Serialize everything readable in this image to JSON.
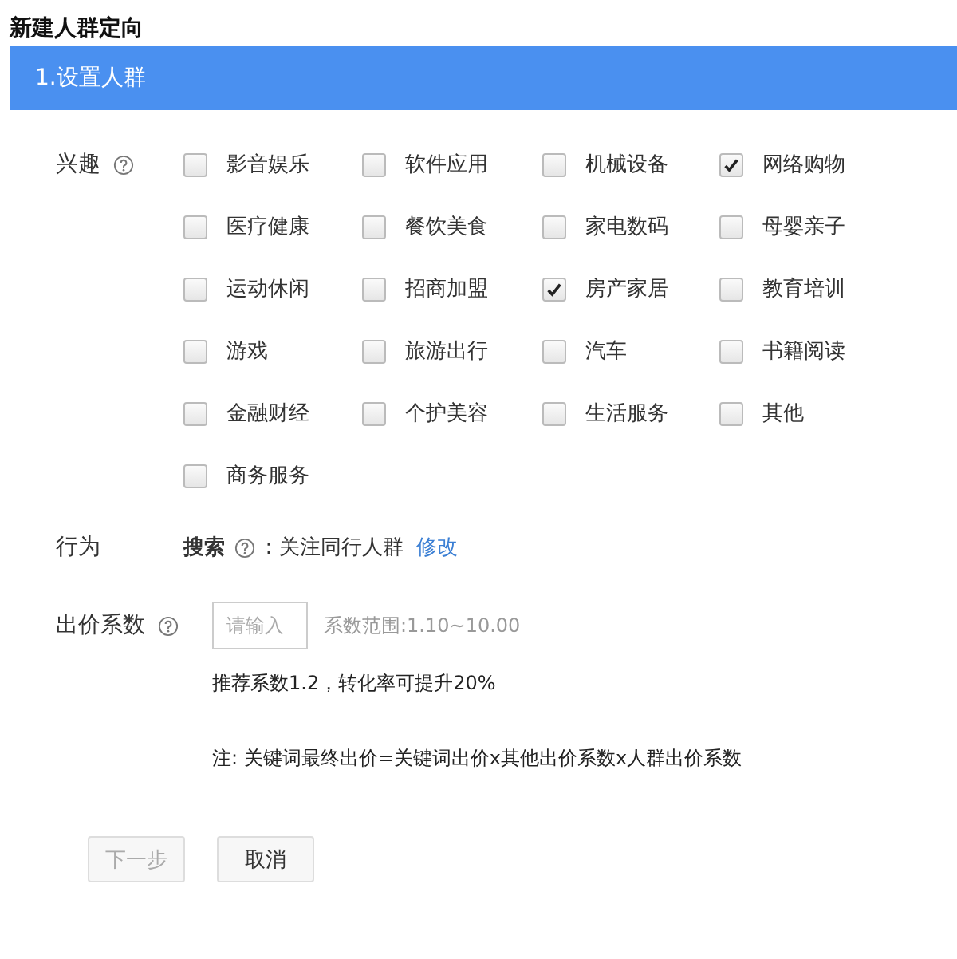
{
  "page_title": "新建人群定向",
  "step": {
    "label": "1.设置人群",
    "selected": true
  },
  "interests": {
    "label": "兴趣",
    "items": [
      {
        "label": "影音娱乐",
        "checked": false
      },
      {
        "label": "软件应用",
        "checked": false
      },
      {
        "label": "机械设备",
        "checked": false
      },
      {
        "label": "网络购物",
        "checked": true
      },
      {
        "label": "医疗健康",
        "checked": false
      },
      {
        "label": "餐饮美食",
        "checked": false
      },
      {
        "label": "家电数码",
        "checked": false
      },
      {
        "label": "母婴亲子",
        "checked": false
      },
      {
        "label": "运动休闲",
        "checked": false
      },
      {
        "label": "招商加盟",
        "checked": false
      },
      {
        "label": "房产家居",
        "checked": true
      },
      {
        "label": "教育培训",
        "checked": false
      },
      {
        "label": "游戏",
        "checked": false
      },
      {
        "label": "旅游出行",
        "checked": false
      },
      {
        "label": "汽车",
        "checked": false
      },
      {
        "label": "书籍阅读",
        "checked": false
      },
      {
        "label": "金融财经",
        "checked": false
      },
      {
        "label": "个护美容",
        "checked": false
      },
      {
        "label": "生活服务",
        "checked": false
      },
      {
        "label": "其他",
        "checked": false
      },
      {
        "label": "商务服务",
        "checked": false
      }
    ]
  },
  "behavior": {
    "label": "行为",
    "type": "搜索",
    "value": "：关注同行人群",
    "link": "修改"
  },
  "bid": {
    "label": "出价系数",
    "placeholder": "请输入",
    "range": "系数范围:1.10~10.00",
    "recommendation": "推荐系数1.2，转化率可提升20%",
    "note": "注: 关键词最终出价=关键词出价x其他出价系数x人群出价系数"
  },
  "buttons": [
    {
      "label": "下一步",
      "disabled": true
    },
    {
      "label": "取消",
      "disabled": false
    }
  ]
}
